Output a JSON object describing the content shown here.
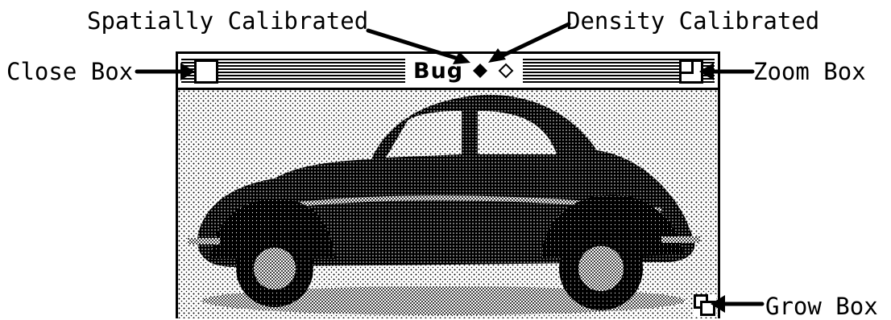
{
  "callouts": {
    "spatially_calibrated": "Spatially Calibrated",
    "density_calibrated": "Density Calibrated",
    "close_box": "Close Box",
    "zoom_box": "Zoom Box",
    "grow_box": "Grow Box"
  },
  "window": {
    "title": "Bug",
    "spatial_indicator": "filled-diamond-icon",
    "density_indicator": "hollow-diamond-icon",
    "content": "halftone image of a Volkswagen Beetle car"
  }
}
